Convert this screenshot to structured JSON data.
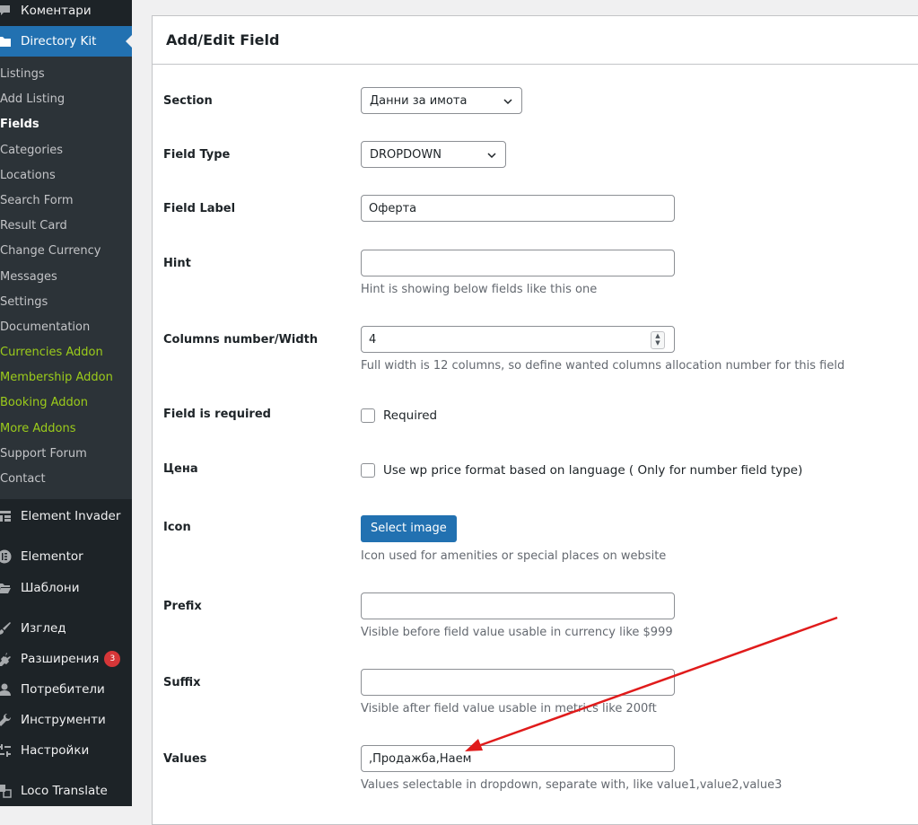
{
  "sidebar": {
    "comments": "Коментари",
    "directory_kit": "Directory Kit",
    "sub_items": [
      {
        "label": "Listings"
      },
      {
        "label": "Add Listing"
      },
      {
        "label": "Fields"
      },
      {
        "label": "Categories"
      },
      {
        "label": "Locations"
      },
      {
        "label": "Search Form"
      },
      {
        "label": "Result Card"
      },
      {
        "label": "Change Currency"
      },
      {
        "label": "Messages"
      },
      {
        "label": "Settings"
      },
      {
        "label": "Documentation"
      },
      {
        "label": "Currencies Addon"
      },
      {
        "label": "Membership Addon"
      },
      {
        "label": "Booking Addon"
      },
      {
        "label": "More Addons"
      },
      {
        "label": "Support Forum"
      },
      {
        "label": "Contact"
      }
    ],
    "element_invader": "Element Invader",
    "elementor": "Elementor",
    "templates": "Шаблони",
    "appearance": "Изглед",
    "plugins": "Разширения",
    "plugins_badge": "3",
    "users": "Потребители",
    "tools": "Инструменти",
    "settings": "Настройки",
    "loco": "Loco Translate"
  },
  "panel": {
    "title": "Add/Edit Field"
  },
  "form": {
    "section": {
      "label": "Section",
      "value": "Данни за имота"
    },
    "field_type": {
      "label": "Field Type",
      "value": "DROPDOWN"
    },
    "field_label": {
      "label": "Field Label",
      "value": "Оферта"
    },
    "hint": {
      "label": "Hint",
      "value": "",
      "help": "Hint is showing below fields like this one"
    },
    "columns": {
      "label": "Columns number/Width",
      "value": "4",
      "help": "Full width is 12 columns, so define wanted columns allocation number for this field"
    },
    "required": {
      "label": "Field is required",
      "checkbox": "Required",
      "checked": false
    },
    "price": {
      "label": "Цена",
      "checkbox": "Use wp price format based on language ( Only for number field type)",
      "checked": false
    },
    "icon": {
      "label": "Icon",
      "button": "Select image",
      "help": "Icon used for amenities or special places on website"
    },
    "prefix": {
      "label": "Prefix",
      "value": "",
      "help": "Visible before field value usable in currency like $999"
    },
    "suffix": {
      "label": "Suffix",
      "value": "",
      "help": "Visible after field value usable in metrics like 200ft"
    },
    "values": {
      "label": "Values",
      "value": ",Продажба,Наем",
      "help": "Values selectable in dropdown, separate with, like value1,value2,value3"
    }
  },
  "colors": {
    "accent": "#2271b1",
    "sidebar_bg": "#1d2327",
    "addon_green": "#9ccc1b",
    "annotation_arrow": "#e01b1b"
  }
}
